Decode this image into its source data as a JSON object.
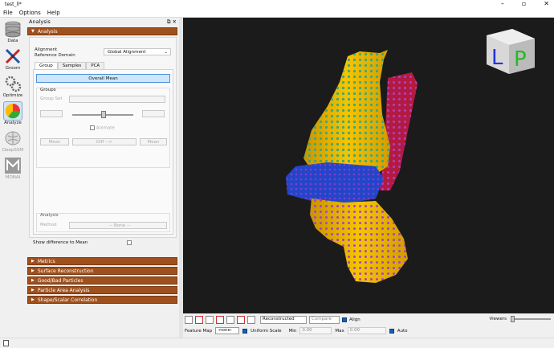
{
  "window": {
    "title": "test_ll*"
  },
  "menu": {
    "file": "File",
    "options": "Options",
    "help": "Help"
  },
  "tools": [
    {
      "label": "Data",
      "icon": "data-icon"
    },
    {
      "label": "Groom",
      "icon": "groom-icon"
    },
    {
      "label": "Optimize",
      "icon": "optimize-icon"
    },
    {
      "label": "Analyze",
      "icon": "analyze-icon"
    },
    {
      "label": "DeepSSM",
      "icon": "deepssm-icon"
    },
    {
      "label": "MONAI",
      "icon": "monai-icon"
    }
  ],
  "panel": {
    "title": "Analysis",
    "analysis_section": "Analysis",
    "alignment_label": "Alignment",
    "ref_domain_label": "Reference Domain",
    "alignment_value": "Global Alignment",
    "tabs": [
      "Group",
      "Samples",
      "PCA"
    ],
    "overall_mean": "Overall Mean",
    "groups_title": "Groups",
    "group_set_label": "Group Set",
    "animate": "Animate",
    "mean_left": "Mean",
    "diff": "Diff -->",
    "mean_right": "Mean",
    "analysis_sub": "Analysis",
    "method_label": "Method",
    "method_value": "-- None --",
    "show_diff": "Show difference to Mean",
    "sections": [
      "Metrics",
      "Surface Reconstruction",
      "Good/Bad Particles",
      "Particle Area Analysis",
      "Shape/Scalar Correlation"
    ]
  },
  "viewer": {
    "orientation_cube": {
      "left": "L",
      "right": "P"
    },
    "view_mode": "Reconstructed",
    "compare": "Compare",
    "align": "Align",
    "viewers_label": "Viewers",
    "feature_map_label": "Feature Map",
    "feature_map_value": "-none-",
    "uniform_scale": "Uniform Scale",
    "min_label": "Min",
    "min_value": "0.00",
    "max_label": "Max",
    "max_value": "0.00",
    "auto": "Auto"
  },
  "colors": {
    "section_bg": "#a0501c",
    "viewport_bg": "#1b1b1b",
    "femur": "#e8b400",
    "tibia": "#2445c8",
    "fibula": "#c81e4b"
  }
}
